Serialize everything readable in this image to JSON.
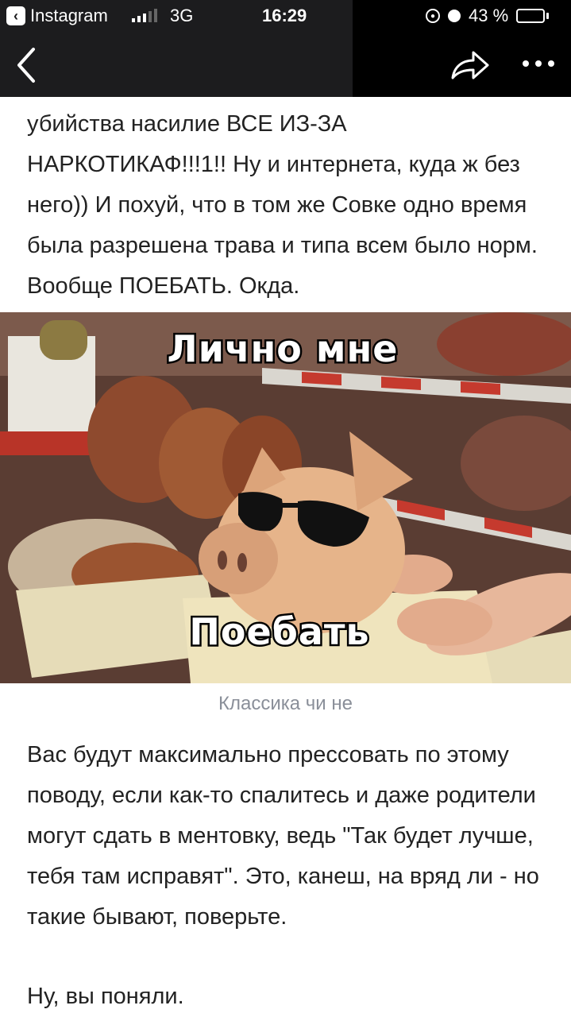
{
  "status_bar": {
    "back_app_label": "Instagram",
    "network": "3G",
    "time": "16:29",
    "battery_percent": "43 %",
    "battery_level": 0.43,
    "icons": [
      "back-app-icon",
      "signal-icon",
      "rotation-lock-icon",
      "alarm-icon",
      "battery-icon"
    ]
  },
  "nav_bar": {
    "icons": [
      "back-chevron-icon",
      "share-icon",
      "more-icon"
    ]
  },
  "article": {
    "paragraph_1": "убийства насилие ВСЕ ИЗ-ЗА НАРКОТИКАФ!!!1!! Ну и интернета, куда ж без него)) И похуй, что в том же Совке одно время была разрешена трава и типа всем было норм. Вообще ПОЕБАТЬ. Окда.",
    "image": {
      "top_text": "Лично мне",
      "bottom_text": "Поебать"
    },
    "caption": "Классика чи не",
    "paragraph_2": "Вас будут максимально прессовать по этому поводу, если как-то спалитесь и даже родители могут сдать в ментовку, ведь \"Так будет лучше, тебя там исправят\". Это, канеш, на вряд ли - но такие бывают, поверьте.",
    "paragraph_3": "Ну, вы поняли."
  },
  "colors": {
    "bar_dark": "#1c1c1e",
    "bar_black": "#000000",
    "text": "#222222",
    "caption": "#8a8f99"
  }
}
